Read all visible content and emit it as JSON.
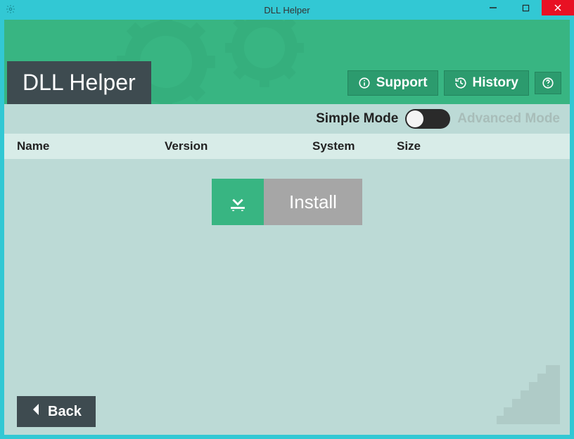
{
  "window": {
    "title": "DLL Helper"
  },
  "app": {
    "title": "DLL Helper"
  },
  "header_buttons": {
    "support": "Support",
    "history": "History"
  },
  "mode": {
    "simple": "Simple Mode",
    "advanced": "Advanced Mode",
    "state": "simple"
  },
  "columns": {
    "name": "Name",
    "version": "Version",
    "system": "System",
    "size": "Size"
  },
  "actions": {
    "install": "Install",
    "back": "Back"
  },
  "colors": {
    "outer": "#32c8d4",
    "primary": "#38b582",
    "dark": "#3e4b50",
    "close": "#e81123"
  },
  "rows": []
}
